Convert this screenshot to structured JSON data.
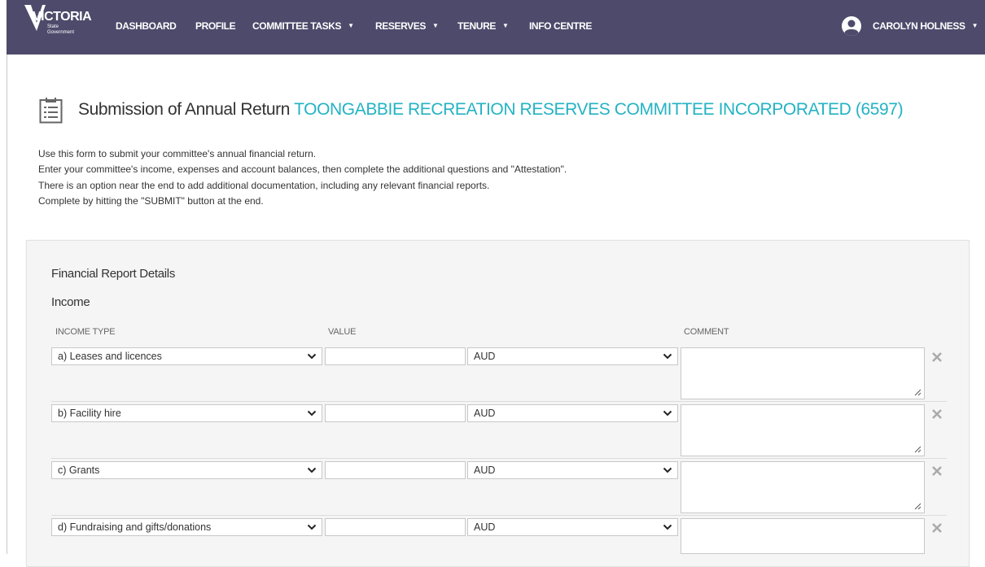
{
  "nav": {
    "logo_text": "VICTORIA",
    "logo_sub1": "State",
    "logo_sub2": "Government",
    "items": [
      {
        "label": "DASHBOARD",
        "dropdown": false
      },
      {
        "label": "PROFILE",
        "dropdown": false
      },
      {
        "label": "COMMITTEE TASKS",
        "dropdown": true
      },
      {
        "label": "RESERVES",
        "dropdown": true
      },
      {
        "label": "TENURE",
        "dropdown": true
      },
      {
        "label": "INFO CENTRE",
        "dropdown": false
      }
    ],
    "user_name": "CAROLYN HOLNESS",
    "user_icon": "user-circle-icon",
    "bg_color": "#4e4a6b"
  },
  "page": {
    "title_prefix": "Submission of Annual Return",
    "title_org": "TOONGABBIE RECREATION RESERVES COMMITTEE INCORPORATED (6597)",
    "title_icon": "form-list-icon",
    "org_color": "#23b3c3",
    "intro": [
      "Use this form to submit your committee's annual financial return.",
      "Enter your committee's income, expenses and account balances, then complete the additional questions and \"Attestation\".",
      "There is an option near the end to add additional documentation, including any relevant financial reports.",
      "Complete by hitting the \"SUBMIT\" button at the end."
    ]
  },
  "financial": {
    "section_title": "Financial Report Details",
    "income_title": "Income",
    "columns": {
      "income_type": "INCOME TYPE",
      "value": "VALUE",
      "comment": "COMMENT"
    },
    "rows": [
      {
        "income_type": "a) Leases and licences",
        "value": "",
        "currency": "AUD",
        "comment": ""
      },
      {
        "income_type": "b) Facility hire",
        "value": "",
        "currency": "AUD",
        "comment": ""
      },
      {
        "income_type": "c) Grants",
        "value": "",
        "currency": "AUD",
        "comment": ""
      },
      {
        "income_type": "d) Fundraising and gifts/donations",
        "value": "",
        "currency": "AUD",
        "comment": ""
      }
    ],
    "delete_icon": "close-icon"
  }
}
